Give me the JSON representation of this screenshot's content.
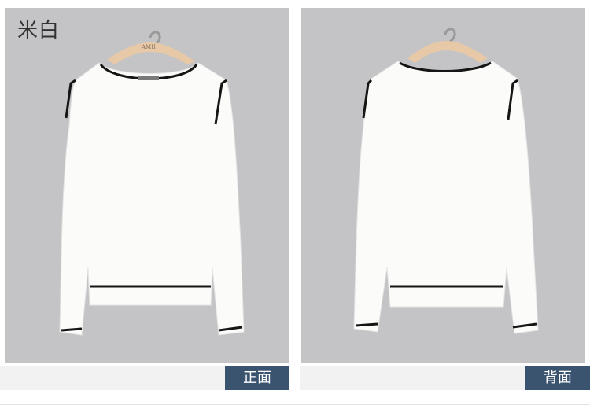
{
  "color_label": "米白",
  "hanger_brand": "AMII",
  "views": [
    {
      "caption": "正面"
    },
    {
      "caption": "背面"
    }
  ],
  "colors": {
    "background_panel": "#c4c4c6",
    "garment": "#fbfbfa",
    "trim": "#151515",
    "hanger": "#e7c8a7",
    "caption_tag": "#3a536f",
    "caption_bar": "#f2f2f3"
  }
}
